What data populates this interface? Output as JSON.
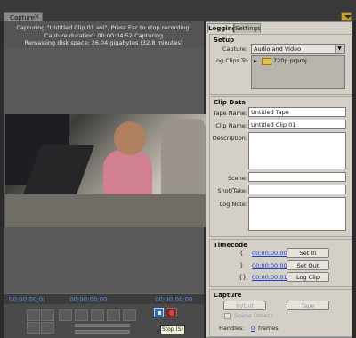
{
  "window": {
    "tab_label": "Capture",
    "close_glyph": "×"
  },
  "status": {
    "line1": "Capturing \"Untitled Clip 01.avi\", Press Esc to stop recording.",
    "line2": "Capture duration: 00:00:04:52 Capturing",
    "line3": "Remaining disk space: 26.04 gigabytes (32.8 minutes)"
  },
  "timecodes": {
    "left": "00;00;00;0(",
    "center": "00;00;00;00",
    "right": "00;00;00;00"
  },
  "transport": {
    "stop_tooltip": "Stop (S)"
  },
  "tabs": {
    "logging": "Logging",
    "settings": "Settings"
  },
  "setup": {
    "heading": "Setup",
    "capture_label": "Capture:",
    "capture_value": "Audio and Video",
    "logclips_label": "Log Clips To:",
    "logclips_value": "720p.prproj"
  },
  "clip_data": {
    "heading": "Clip Data",
    "tape_label": "Tape Name:",
    "tape_value": "Untitled Tape",
    "clip_label": "Clip Name:",
    "clip_value": "Untitled Clip 01",
    "desc_label": "Description:",
    "scene_label": "Scene:",
    "shot_label": "Shot/Take:",
    "lognote_label": "Log Note:"
  },
  "timecode": {
    "heading": "Timecode",
    "in_value": "00;00;00;00",
    "out_value": "00;00;00;00",
    "dur_value": "00;00;00;01",
    "set_in": "Set In",
    "set_out": "Set Out",
    "log_clip": "Log Clip"
  },
  "capture": {
    "heading": "Capture",
    "in_out": "In/Out",
    "tape": "Tape",
    "scene_detect": "Scene Detect",
    "handles_label": "Handles:",
    "handles_value": "0",
    "handles_unit": "frames"
  }
}
